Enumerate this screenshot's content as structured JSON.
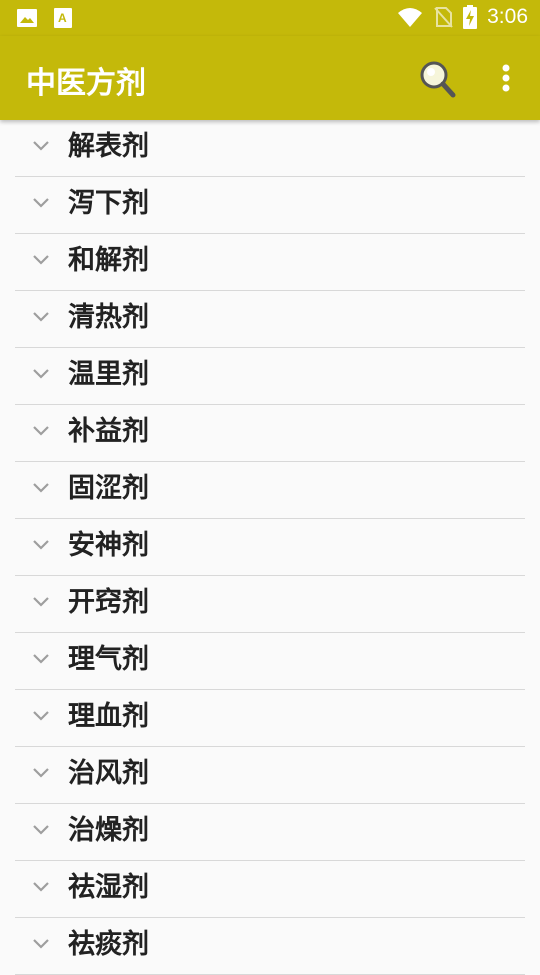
{
  "status_bar": {
    "time": "3:06",
    "icons": [
      "image-icon",
      "text-a-icon",
      "wifi-icon",
      "no-sim-icon",
      "battery-charging-icon"
    ]
  },
  "app_bar": {
    "title": "中医方剂",
    "actions": [
      "search-icon",
      "more-vert-icon"
    ]
  },
  "colors": {
    "accent": "#c4b90a",
    "background": "#fafafa",
    "divider": "#d8d8d8",
    "text": "#222222",
    "chevron": "#9e9e9e"
  },
  "categories": [
    {
      "label": "解表剂"
    },
    {
      "label": "泻下剂"
    },
    {
      "label": "和解剂"
    },
    {
      "label": "清热剂"
    },
    {
      "label": "温里剂"
    },
    {
      "label": "补益剂"
    },
    {
      "label": "固涩剂"
    },
    {
      "label": "安神剂"
    },
    {
      "label": "开窍剂"
    },
    {
      "label": "理气剂"
    },
    {
      "label": "理血剂"
    },
    {
      "label": "治风剂"
    },
    {
      "label": "治燥剂"
    },
    {
      "label": "祛湿剂"
    },
    {
      "label": "祛痰剂"
    }
  ]
}
